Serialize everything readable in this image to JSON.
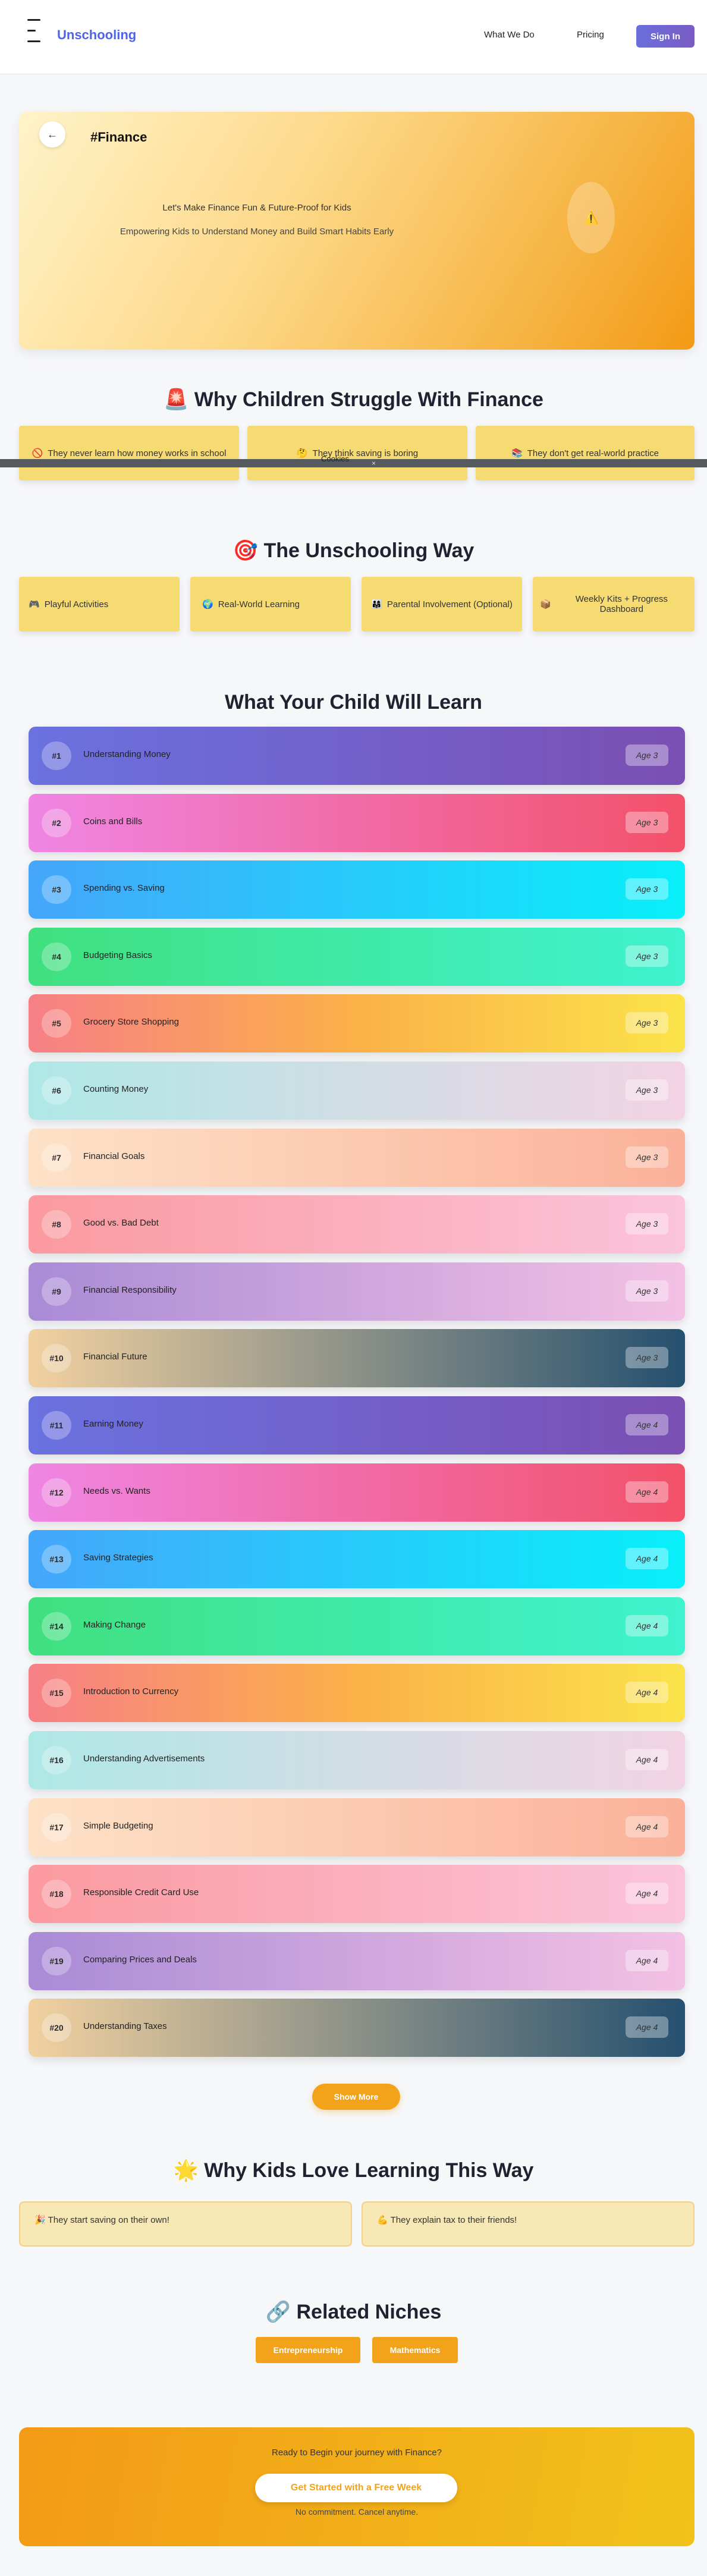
{
  "header": {
    "brand": "Unschooling",
    "nav": [
      "What We Do",
      "Pricing"
    ],
    "signin": "Sign In"
  },
  "hero": {
    "back_icon": "←",
    "tag": "#Finance",
    "title": "Let's Make Finance Fun & Future-Proof for Kids",
    "subtitle": "Empowering Kids to Understand Money and Build Smart Habits Early",
    "badge_icon": "⚠️"
  },
  "struggle": {
    "title": "🚨 Why Children Struggle With Finance",
    "items": [
      {
        "icon": "🚫",
        "text": "They never learn how money works in school"
      },
      {
        "icon": "🤔",
        "text": "They think saving is boring"
      },
      {
        "icon": "📚",
        "text": "They don't get real-world practice"
      }
    ],
    "banner_text": "Cookies",
    "banner_close": "×"
  },
  "way": {
    "title": "🎯 The Unschooling Way",
    "items": [
      {
        "icon": "🎮",
        "text": "Playful Activities"
      },
      {
        "icon": "🌍",
        "text": "Real-World Learning"
      },
      {
        "icon": "👨‍👩‍👧",
        "text": "Parental Involvement (Optional)"
      },
      {
        "icon": "📦",
        "text": "Weekly Kits + Progress Dashboard"
      }
    ]
  },
  "learn": {
    "title": "What Your Child Will Learn",
    "topics": [
      {
        "num": "#1",
        "name": "Understanding Money",
        "age": "Age 3"
      },
      {
        "num": "#2",
        "name": "Coins and Bills",
        "age": "Age 3"
      },
      {
        "num": "#3",
        "name": "Spending vs. Saving",
        "age": "Age 3"
      },
      {
        "num": "#4",
        "name": "Budgeting Basics",
        "age": "Age 3"
      },
      {
        "num": "#5",
        "name": "Grocery Store Shopping",
        "age": "Age 3"
      },
      {
        "num": "#6",
        "name": "Counting Money",
        "age": "Age 3"
      },
      {
        "num": "#7",
        "name": "Financial Goals",
        "age": "Age 3"
      },
      {
        "num": "#8",
        "name": "Good vs. Bad Debt",
        "age": "Age 3"
      },
      {
        "num": "#9",
        "name": "Financial Responsibility",
        "age": "Age 3"
      },
      {
        "num": "#10",
        "name": "Financial Future",
        "age": "Age 3"
      },
      {
        "num": "#11",
        "name": "Earning Money",
        "age": "Age 4"
      },
      {
        "num": "#12",
        "name": "Needs vs. Wants",
        "age": "Age 4"
      },
      {
        "num": "#13",
        "name": "Saving Strategies",
        "age": "Age 4"
      },
      {
        "num": "#14",
        "name": "Making Change",
        "age": "Age 4"
      },
      {
        "num": "#15",
        "name": "Introduction to Currency",
        "age": "Age 4"
      },
      {
        "num": "#16",
        "name": "Understanding Advertisements",
        "age": "Age 4"
      },
      {
        "num": "#17",
        "name": "Simple Budgeting",
        "age": "Age 4"
      },
      {
        "num": "#18",
        "name": "Responsible Credit Card Use",
        "age": "Age 4"
      },
      {
        "num": "#19",
        "name": "Comparing Prices and Deals",
        "age": "Age 4"
      },
      {
        "num": "#20",
        "name": "Understanding Taxes",
        "age": "Age 4"
      }
    ],
    "show_more": "Show More"
  },
  "love": {
    "title": "🌟 Why Kids Love Learning This Way",
    "items": [
      {
        "icon": "🎉",
        "text": "They start saving on their own!"
      },
      {
        "icon": "💪",
        "text": "They explain tax to their friends!"
      }
    ]
  },
  "niches": {
    "title": "🔗 Related Niches",
    "items": [
      "Entrepreneurship",
      "Mathematics"
    ]
  },
  "cta": {
    "title": "Ready to Begin your journey with Finance?",
    "button": "Get Started with a Free Week",
    "note": "No commitment. Cancel anytime."
  }
}
